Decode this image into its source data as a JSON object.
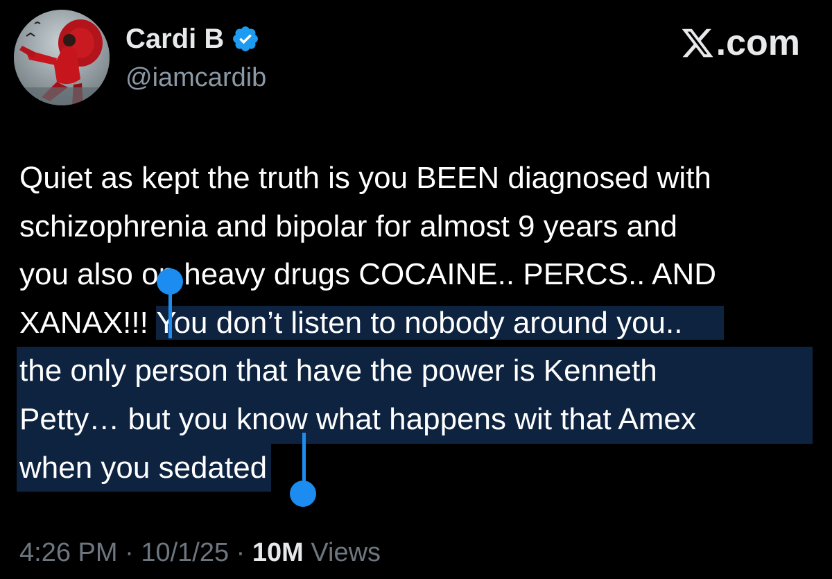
{
  "author": {
    "name": "Cardi B",
    "handle": "@iamcardib",
    "verified": true
  },
  "brand": {
    "label": ".com",
    "full": "X.com"
  },
  "tweet": {
    "lines": [
      "Quiet as kept the truth is you BEEN diagnosed with",
      "schizophrenia and bipolar for almost 9 years and",
      "you also on heavy drugs COCAINE.. PERCS.. AND"
    ],
    "line4_unselected": "XANAX!!! ",
    "selected_lines": [
      "You don’t listen to nobody around you..",
      "the only person that have the power is Kenneth",
      "Petty… but you know what happens wit that Amex",
      "when you sedated"
    ]
  },
  "meta": {
    "time": "4:26 PM",
    "separator": "·",
    "date": "10/1/25",
    "views_count": "10M",
    "views_label": "Views"
  },
  "colors": {
    "background": "#000000",
    "text": "#e7e9ea",
    "secondary_text": "#8b98a5",
    "selection": "#0d2340",
    "selection_handle": "#1d8cf0",
    "verified_badge": "#1d9bf0"
  },
  "icons": [
    "verified-badge-icon",
    "x-logo-icon",
    "avatar-image"
  ]
}
